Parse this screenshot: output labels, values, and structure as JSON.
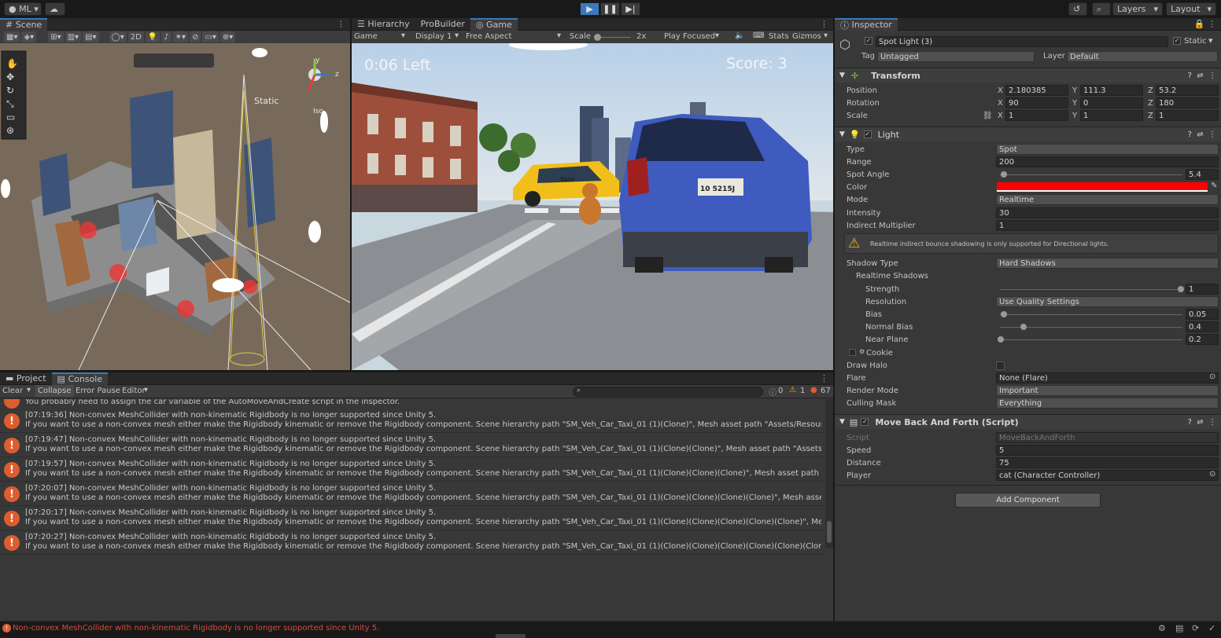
{
  "topbar": {
    "account": "ML",
    "layers": "Layers",
    "layout": "Layout"
  },
  "scene": {
    "tab": "Scene",
    "mode_2d": "2D",
    "static_label": "Static",
    "iso_label": "Iso",
    "gizmo_y": "y",
    "gizmo_z": "z"
  },
  "game": {
    "tabs": [
      "Hierarchy",
      "ProBuilder",
      "Game"
    ],
    "display_mode": "Game",
    "display": "Display 1",
    "aspect": "Free Aspect",
    "scale_label": "Scale",
    "scale_value": "2x",
    "play_focused": "Play Focused",
    "stats": "Stats",
    "gizmos": "Gizmos",
    "time_left": "0:06 Left",
    "score": "Score: 3",
    "plate": "10 5215J",
    "taxi_sign": "TAXI"
  },
  "inspector": {
    "tab": "Inspector",
    "object_name": "Spot Light (3)",
    "static_label": "Static",
    "tag_label": "Tag",
    "tag": "Untagged",
    "layer_label": "Layer",
    "layer": "Default",
    "transform": {
      "title": "Transform",
      "position_label": "Position",
      "rotation_label": "Rotation",
      "scale_label": "Scale",
      "position": [
        "2.180385",
        "111.3",
        "53.2"
      ],
      "rotation": [
        "90",
        "0",
        "180"
      ],
      "scale": [
        "1",
        "1",
        "1"
      ]
    },
    "light": {
      "title": "Light",
      "type_label": "Type",
      "type": "Spot",
      "range_label": "Range",
      "range": "200",
      "spot_angle_label": "Spot Angle",
      "spot_angle": "5.4",
      "color_label": "Color",
      "color": "#ff0000",
      "mode_label": "Mode",
      "mode": "Realtime",
      "intensity_label": "Intensity",
      "intensity": "30",
      "indirect_label": "Indirect Multiplier",
      "indirect": "1",
      "warning": "Realtime indirect bounce shadowing is only supported for Directional lights.",
      "shadow_type_label": "Shadow Type",
      "shadow_type": "Hard Shadows",
      "realtime_shadows_label": "Realtime Shadows",
      "strength_label": "Strength",
      "strength": "1",
      "resolution_label": "Resolution",
      "resolution": "Use Quality Settings",
      "bias_label": "Bias",
      "bias": "0.05",
      "normal_bias_label": "Normal Bias",
      "normal_bias": "0.4",
      "near_plane_label": "Near Plane",
      "near_plane": "0.2",
      "cookie_label": "Cookie",
      "draw_halo_label": "Draw Halo",
      "flare_label": "Flare",
      "flare": "None (Flare)",
      "render_mode_label": "Render Mode",
      "render_mode": "Important",
      "culling_label": "Culling Mask",
      "culling": "Everything"
    },
    "script": {
      "title": "Move Back And Forth (Script)",
      "script_label": "Script",
      "script": "MoveBackAndForth",
      "speed_label": "Speed",
      "speed": "5",
      "distance_label": "Distance",
      "distance": "75",
      "player_label": "Player",
      "player": "cat (Character Controller)"
    },
    "add_component": "Add Component"
  },
  "console": {
    "tabs": [
      "Project",
      "Console"
    ],
    "clear": "Clear",
    "collapse": "Collapse",
    "error_pause": "Error Pause",
    "editor": "Editor",
    "count_info": "0",
    "count_warn": "1",
    "count_err": "67",
    "partial_line": "You probably need to assign the car variable of the AutoMoveAndCreate script in the inspector.",
    "entries": [
      {
        "l1": "[07:19:36] Non-convex MeshCollider with non-kinematic Rigidbody is no longer supported since Unity 5.",
        "l2": "If you want to use a non-convex mesh either make the Rigidbody kinematic or remove the Rigidbody component. Scene hierarchy path \"SM_Veh_Car_Taxi_01 (1)(Clone)\", Mesh asset path \"Assets/Resources/Models/SM_Ve"
      },
      {
        "l1": "[07:19:47] Non-convex MeshCollider with non-kinematic Rigidbody is no longer supported since Unity 5.",
        "l2": "If you want to use a non-convex mesh either make the Rigidbody kinematic or remove the Rigidbody component. Scene hierarchy path \"SM_Veh_Car_Taxi_01 (1)(Clone)(Clone)\", Mesh asset path \"Assets/Resources/Models/SM"
      },
      {
        "l1": "[07:19:57] Non-convex MeshCollider with non-kinematic Rigidbody is no longer supported since Unity 5.",
        "l2": "If you want to use a non-convex mesh either make the Rigidbody kinematic or remove the Rigidbody component. Scene hierarchy path \"SM_Veh_Car_Taxi_01 (1)(Clone)(Clone)(Clone)\", Mesh asset path \"Assets/Resources/Mod"
      },
      {
        "l1": "[07:20:07] Non-convex MeshCollider with non-kinematic Rigidbody is no longer supported since Unity 5.",
        "l2": "If you want to use a non-convex mesh either make the Rigidbody kinematic or remove the Rigidbody component. Scene hierarchy path \"SM_Veh_Car_Taxi_01 (1)(Clone)(Clone)(Clone)(Clone)\", Mesh asset path \"Assets/Resou"
      },
      {
        "l1": "[07:20:17] Non-convex MeshCollider with non-kinematic Rigidbody is no longer supported since Unity 5.",
        "l2": "If you want to use a non-convex mesh either make the Rigidbody kinematic or remove the Rigidbody component. Scene hierarchy path \"SM_Veh_Car_Taxi_01 (1)(Clone)(Clone)(Clone)(Clone)(Clone)\", Mesh asset path \"Asset"
      },
      {
        "l1": "[07:20:27] Non-convex MeshCollider with non-kinematic Rigidbody is no longer supported since Unity 5.",
        "l2": "If you want to use a non-convex mesh either make the Rigidbody kinematic or remove the Rigidbody component. Scene hierarchy path \"SM_Veh_Car_Taxi_01 (1)(Clone)(Clone)(Clone)(Clone)(Clone)(Clone)\", Mesh asset path"
      }
    ]
  },
  "status": {
    "message": "Non-convex MeshCollider with non-kinematic Rigidbody is no longer supported since Unity 5."
  }
}
